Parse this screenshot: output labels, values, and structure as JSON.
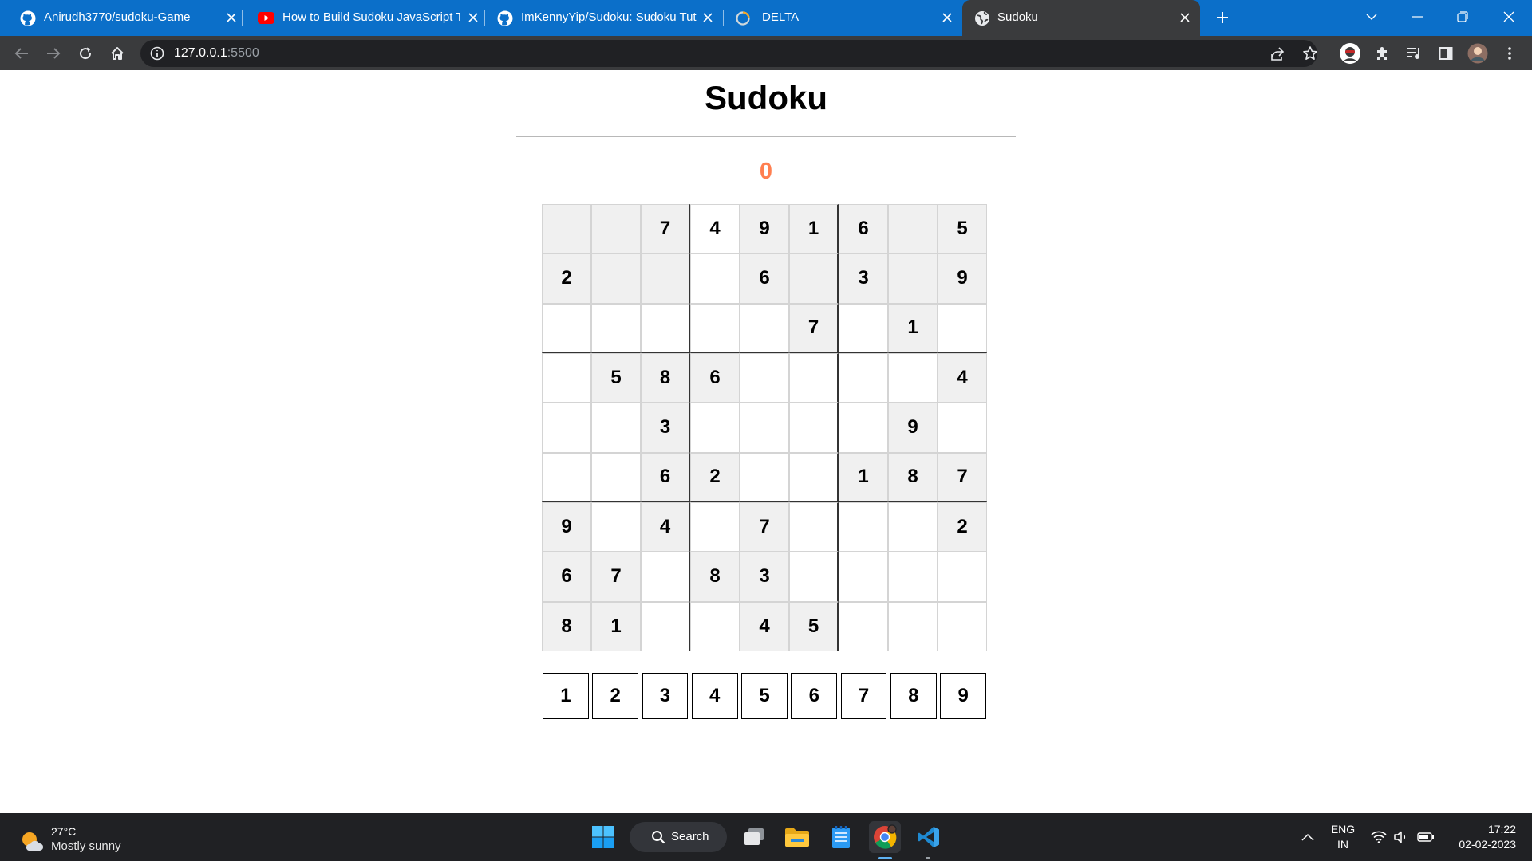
{
  "browser": {
    "tabs": [
      {
        "title": "Anirudh3770/sudoku-Game",
        "favicon": "github-icon",
        "active": false
      },
      {
        "title": "How to Build Sudoku JavaScript T",
        "favicon": "youtube-icon",
        "active": false
      },
      {
        "title": "ImKennyYip/Sudoku: Sudoku Tut",
        "favicon": "github-icon",
        "active": false
      },
      {
        "title": "DELTA",
        "favicon": "loading-icon",
        "active": false
      },
      {
        "title": "Sudoku",
        "favicon": "globe-icon",
        "active": true
      }
    ],
    "address": {
      "host": "127.0.0.1",
      "port": ":5500"
    },
    "colors": {
      "tabstrip": "#0b6fc9",
      "toolbar": "#3a3b3d"
    }
  },
  "page": {
    "title": "Sudoku",
    "errors": "0",
    "errors_color": "#ff7f50",
    "board": [
      [
        "",
        "",
        "7",
        "4",
        "9",
        "1",
        "6",
        "",
        "5"
      ],
      [
        "2",
        "",
        "",
        "",
        "6",
        "",
        "3",
        "",
        "9"
      ],
      [
        "",
        "",
        "",
        "",
        "",
        "7",
        "",
        "1",
        ""
      ],
      [
        "",
        "5",
        "8",
        "6",
        "",
        "",
        "",
        "",
        "4"
      ],
      [
        "",
        "",
        "3",
        "",
        "",
        "",
        "",
        "9",
        ""
      ],
      [
        "",
        "",
        "6",
        "2",
        "",
        "",
        "1",
        "8",
        "7"
      ],
      [
        "9",
        "",
        "4",
        "",
        "7",
        "",
        "",
        "",
        "2"
      ],
      [
        "6",
        "7",
        "",
        "8",
        "3",
        "",
        "",
        "",
        ""
      ],
      [
        "8",
        "1",
        "",
        "",
        "4",
        "5",
        "",
        "",
        ""
      ]
    ],
    "shaded": [
      [
        1,
        1,
        1,
        0,
        1,
        1,
        1,
        1,
        1
      ],
      [
        1,
        1,
        1,
        0,
        1,
        1,
        1,
        1,
        1
      ],
      [
        0,
        0,
        0,
        0,
        0,
        1,
        0,
        1,
        0
      ],
      [
        0,
        1,
        1,
        1,
        0,
        0,
        0,
        0,
        1
      ],
      [
        0,
        0,
        1,
        0,
        0,
        0,
        0,
        1,
        0
      ],
      [
        0,
        0,
        1,
        1,
        0,
        0,
        1,
        1,
        1
      ],
      [
        1,
        0,
        1,
        0,
        1,
        0,
        0,
        0,
        1
      ],
      [
        1,
        1,
        0,
        1,
        1,
        0,
        0,
        0,
        0
      ],
      [
        1,
        1,
        0,
        0,
        1,
        1,
        0,
        0,
        0
      ]
    ],
    "digits": [
      "1",
      "2",
      "3",
      "4",
      "5",
      "6",
      "7",
      "8",
      "9"
    ]
  },
  "taskbar": {
    "weather": {
      "temp": "27°C",
      "condition": "Mostly sunny"
    },
    "search_label": "Search",
    "apps": [
      "windows-start-icon",
      "search-icon",
      "task-view-icon",
      "file-explorer-icon",
      "notepad-icon",
      "chrome-icon",
      "vscode-icon"
    ],
    "language": {
      "line1": "ENG",
      "line2": "IN"
    },
    "clock": {
      "time": "17:22",
      "date": "02-02-2023"
    }
  }
}
